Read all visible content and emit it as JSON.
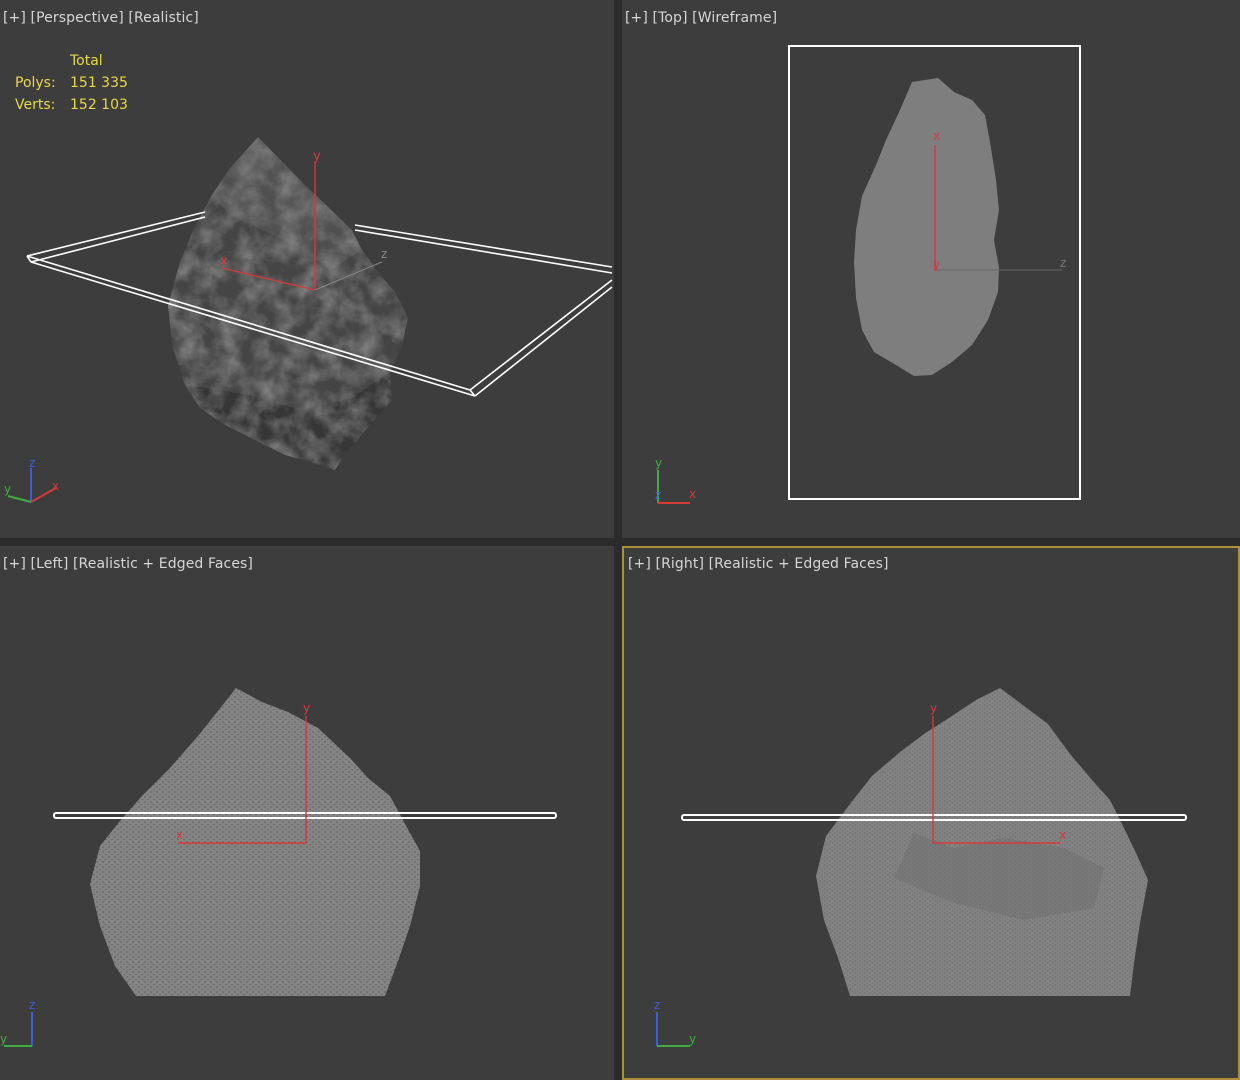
{
  "viewports": {
    "perspective": {
      "label_plus": "[+]",
      "label_view": "[Perspective]",
      "label_mode": "[Realistic]"
    },
    "top": {
      "label_plus": "[+]",
      "label_view": "[Top]",
      "label_mode": "[Wireframe]"
    },
    "left": {
      "label_plus": "[+]",
      "label_view": "[Left]",
      "label_mode": "[Realistic + Edged Faces]"
    },
    "right": {
      "label_plus": "[+]",
      "label_view": "[Right]",
      "label_mode": "[Realistic + Edged Faces]"
    }
  },
  "stats": {
    "header": "Total",
    "polys_label": "Polys:",
    "polys_value": "151 335",
    "verts_label": "Verts:",
    "verts_value": "152 103"
  },
  "axes": {
    "x": "x",
    "y": "y",
    "z": "z"
  },
  "colors": {
    "viewport_bg": "#3d3d3d",
    "active_border": "#b08e3a",
    "stats_text": "#e8d84a",
    "axis_x": "#d43a3a",
    "axis_y": "#3fae3f",
    "axis_z": "#3a5fd8",
    "rock_dark": "#474747",
    "rock_gray": "#7e7e7e"
  }
}
